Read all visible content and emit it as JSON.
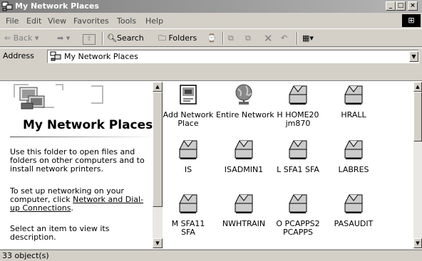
{
  "window": {
    "title": "My Network Places",
    "minimize": "_",
    "maximize": "□",
    "close": "×"
  },
  "menu": [
    {
      "label": "File"
    },
    {
      "label": "Edit"
    },
    {
      "label": "View"
    },
    {
      "label": "Favorites"
    },
    {
      "label": "Tools"
    },
    {
      "label": "Help"
    }
  ],
  "toolbar": {
    "back": "Back",
    "search": "Search",
    "folders": "Folders"
  },
  "address": {
    "label": "Address",
    "value": "My Network Places"
  },
  "left_pane": {
    "title": "My Network Places",
    "para1": "Use this folder to open files and folders on other computers and to install network printers.",
    "para2_prefix": "To set up networking on your computer, click ",
    "para2_link": "Network and Dial-up Connections",
    "para2_suffix": ".",
    "para3": "Select an item to view its description."
  },
  "items": [
    {
      "label": "Add Network Place",
      "icon": "add-network-place-icon"
    },
    {
      "label": "Entire Network",
      "icon": "globe-icon"
    },
    {
      "label": "H HOME20 jm870",
      "icon": "network-share-icon"
    },
    {
      "label": "HRALL",
      "icon": "network-share-icon"
    },
    {
      "label": "IS",
      "icon": "network-share-icon"
    },
    {
      "label": "ISADMIN1",
      "icon": "network-share-icon"
    },
    {
      "label": "L SFA1 SFA",
      "icon": "network-share-icon"
    },
    {
      "label": "LABRES",
      "icon": "network-share-icon"
    },
    {
      "label": "M SFA11 SFA",
      "icon": "network-share-icon"
    },
    {
      "label": "NWHTRAIN",
      "icon": "network-share-icon"
    },
    {
      "label": "O PCAPPS2 PCAPPS",
      "icon": "network-share-icon"
    },
    {
      "label": "PASAUDIT",
      "icon": "network-share-icon"
    }
  ],
  "status": {
    "text": "33 object(s)"
  }
}
